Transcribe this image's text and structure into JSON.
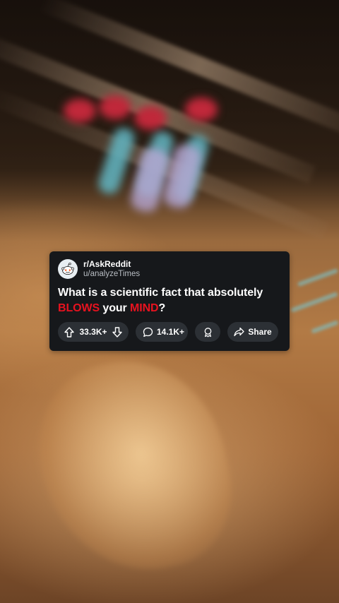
{
  "post": {
    "subreddit": "r/AskReddit",
    "username": "u/analyzeTimes",
    "title_parts": {
      "part1": "What is a scientific fact that absolutely ",
      "highlight1": "BLOWS",
      "part2": " your ",
      "highlight2": "MIND",
      "part3": "?"
    },
    "votes": "33.3K+",
    "comments": "14.1K+",
    "share_label": "Share"
  },
  "icons": {
    "avatar": "reddit-snoo-icon",
    "upvote": "arrow-up-icon",
    "downvote": "arrow-down-icon",
    "comment": "comment-bubble-icon",
    "award": "award-icon",
    "share": "share-arrow-icon"
  },
  "colors": {
    "card_bg": "#16181b",
    "pill_bg": "#2c3035",
    "highlight": "#e8121f",
    "text": "#ffffff",
    "muted_text": "#b9bec4"
  }
}
